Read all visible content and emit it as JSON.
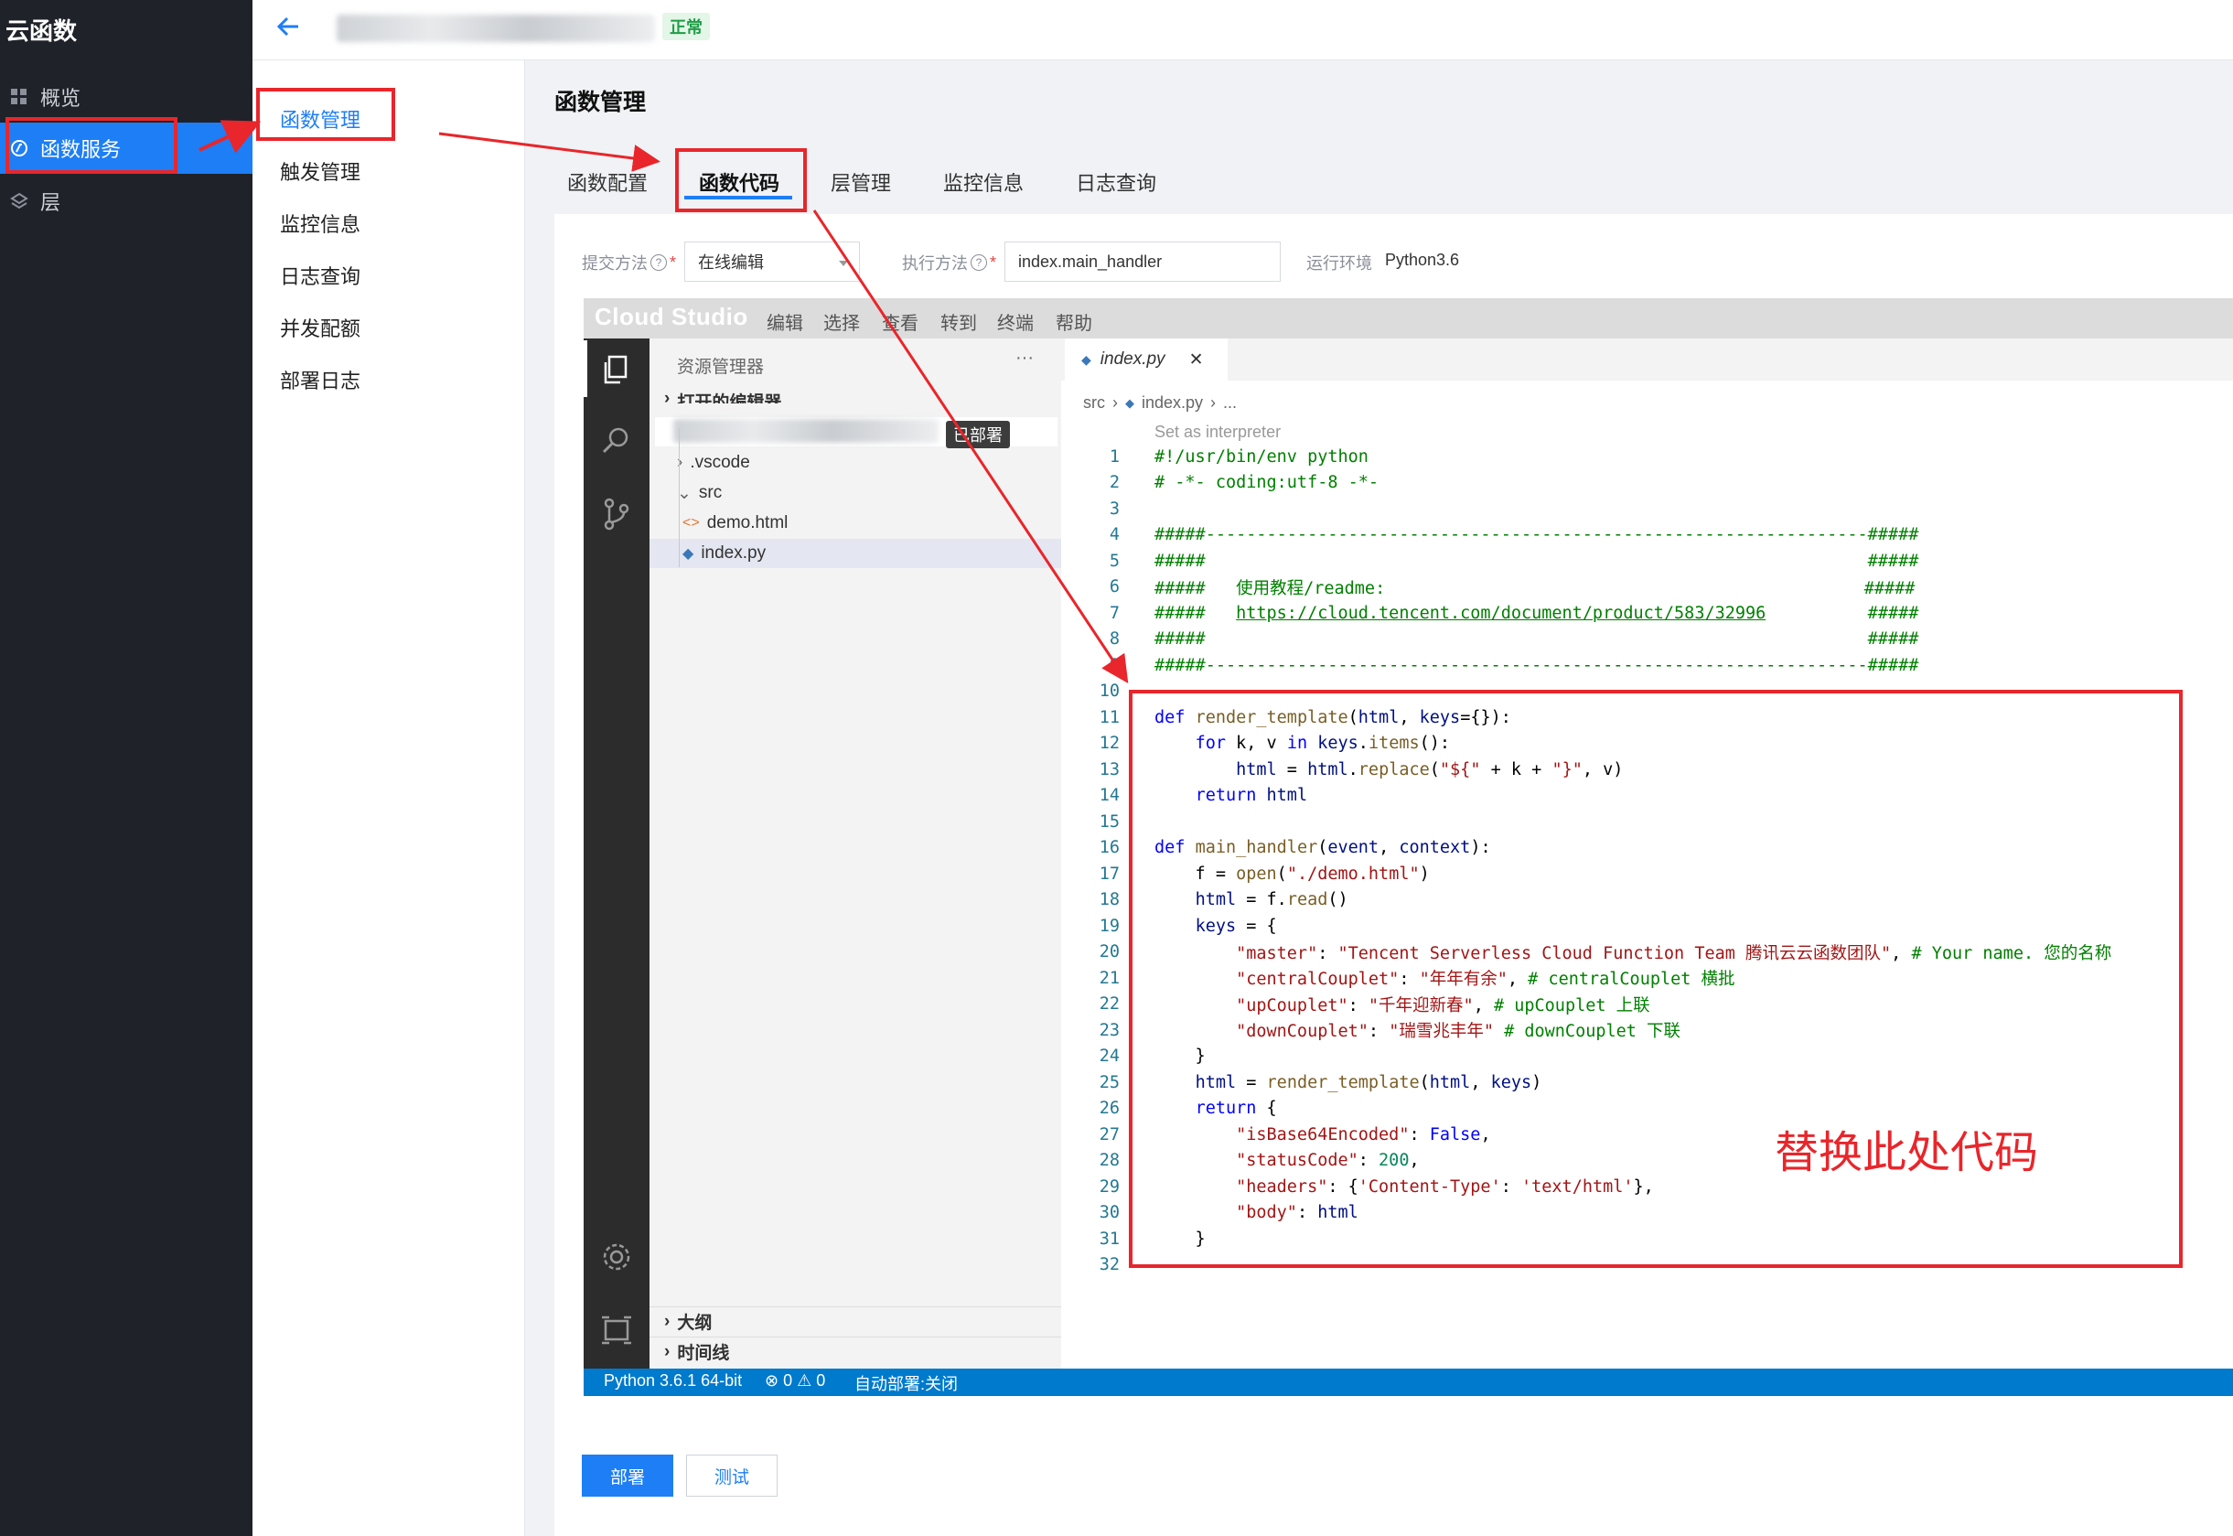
{
  "app": {
    "title": "云函数"
  },
  "sidebar": {
    "items": [
      {
        "label": "概览",
        "icon": "grid-icon"
      },
      {
        "label": "函数服务",
        "icon": "function-icon"
      },
      {
        "label": "层",
        "icon": "layers-icon"
      }
    ]
  },
  "header": {
    "status_badge": "正常"
  },
  "subnav": {
    "items": [
      "函数管理",
      "触发管理",
      "监控信息",
      "日志查询",
      "并发配额",
      "部署日志"
    ]
  },
  "main": {
    "title": "函数管理",
    "tabs": [
      "函数配置",
      "函数代码",
      "层管理",
      "监控信息",
      "日志查询"
    ],
    "active_tab": "函数代码"
  },
  "form": {
    "submit_method_label": "提交方法",
    "submit_method_value": "在线编辑",
    "exec_method_label": "执行方法",
    "exec_method_value": "index.main_handler",
    "runtime_label": "运行环境",
    "runtime_value": "Python3.6"
  },
  "ide": {
    "brand": "Cloud Studio",
    "menu": [
      "编辑",
      "选择",
      "查看",
      "转到",
      "终端",
      "帮助"
    ],
    "explorer_title": "资源管理器",
    "explorer_more": "···",
    "open_editors": "打开的编辑器",
    "deployed_badge": "已部署",
    "tree": [
      ".vscode",
      "src",
      "demo.html",
      "index.py"
    ],
    "outline": "大纲",
    "timeline": "时间线",
    "editor_tab": "index.py",
    "breadcrumb_src": "src",
    "breadcrumb_file": "index.py",
    "breadcrumb_more": "...",
    "interpreter_hint": "Set as interpreter",
    "code_lines": [
      "#!/usr/bin/env python",
      "# -*- coding:utf-8 -*-",
      "",
      "#####-----------------------------------------------------------------#####",
      "#####                                                                 #####",
      "#####   使用教程/readme:                                               #####",
      "#####   https://cloud.tencent.com/document/product/583/32996          #####",
      "#####                                                                 #####",
      "#####-----------------------------------------------------------------#####",
      "",
      "def render_template(html, keys={}):",
      "    for k, v in keys.items():",
      "        html = html.replace(\"${\" + k + \"}\", v)",
      "    return html",
      "",
      "def main_handler(event, context):",
      "    f = open(\"./demo.html\")",
      "    html = f.read()",
      "    keys = {",
      "        \"master\": \"Tencent Serverless Cloud Function Team 腾讯云云函数团队\", # Your name. 您的名称",
      "        \"centralCouplet\": \"年年有余\", # centralCouplet 横批",
      "        \"upCouplet\": \"千年迎新春\", # upCouplet 上联",
      "        \"downCouplet\": \"瑞雪兆丰年\" # downCouplet 下联",
      "    }",
      "    html = render_template(html, keys)",
      "    return {",
      "        \"isBase64Encoded\": False,",
      "        \"statusCode\": 200,",
      "        \"headers\": {'Content-Type': 'text/html'},",
      "        \"body\": html",
      "    }",
      ""
    ],
    "status": {
      "python": "Python 3.6.1 64-bit",
      "problems": "⊗ 0 ⚠ 0",
      "autodeploy": "自动部署:关闭"
    }
  },
  "actions": {
    "deploy": "部署",
    "test": "测试"
  },
  "annotation": {
    "replace_note": "替换此处代码"
  },
  "colors": {
    "accent": "#1e7ef5",
    "annotation_red": "#e8262b",
    "statusbar": "#007acc",
    "sidebar_bg": "#1f2229"
  }
}
